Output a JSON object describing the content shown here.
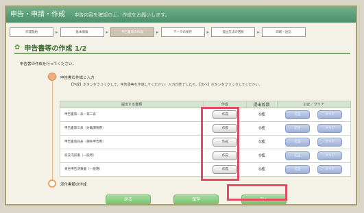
{
  "header": {
    "title": "申告・申請・作成",
    "subtitle": "申告内容を確認の上、作成をお願いします。"
  },
  "steps": [
    {
      "label": "作成開始"
    },
    {
      "label": "基本情報"
    },
    {
      "label": "申告書等の作成",
      "active": true
    },
    {
      "label": "データの保存"
    },
    {
      "label": "提出方法の選択"
    },
    {
      "label": "印刷・送信"
    }
  ],
  "section": {
    "title": "申告書等の作成 1/2"
  },
  "instruction": "申告書の作成を行ってください。",
  "step1": {
    "label": "申告書の作成と入力",
    "description": "【作成】ボタンをクリックして、申告書等を作成してください。入力が終了したら、【次へ】ボタンをクリックしてください。"
  },
  "step2": {
    "label": "添付書類の作成"
  },
  "table": {
    "headers": [
      "提出する書類",
      "作成",
      "提出枚数",
      "訂正／クリア"
    ],
    "rows": [
      {
        "doc": "申告書第一表・第二表",
        "make": "作成",
        "count": "0枚",
        "fix": "訂正",
        "clear": "クリア"
      },
      {
        "doc": "申告書第三表（分離課税用）",
        "make": "作成",
        "count": "0枚",
        "fix": "訂正",
        "clear": "クリア"
      },
      {
        "doc": "申告書第四表（損失申告用）",
        "make": "作成",
        "count": "0枚",
        "fix": "訂正",
        "clear": "クリア"
      },
      {
        "doc": "収支内訳書（一般用）",
        "make": "作成",
        "count": "0枚",
        "fix": "訂正",
        "clear": "クリア"
      },
      {
        "doc": "青色申告決算書（一般用）",
        "make": "作成",
        "count": "0枚",
        "fix": "訂正",
        "clear": "クリア"
      }
    ]
  },
  "nav": {
    "back": "戻る",
    "save": "保存",
    "next": "次へ"
  }
}
